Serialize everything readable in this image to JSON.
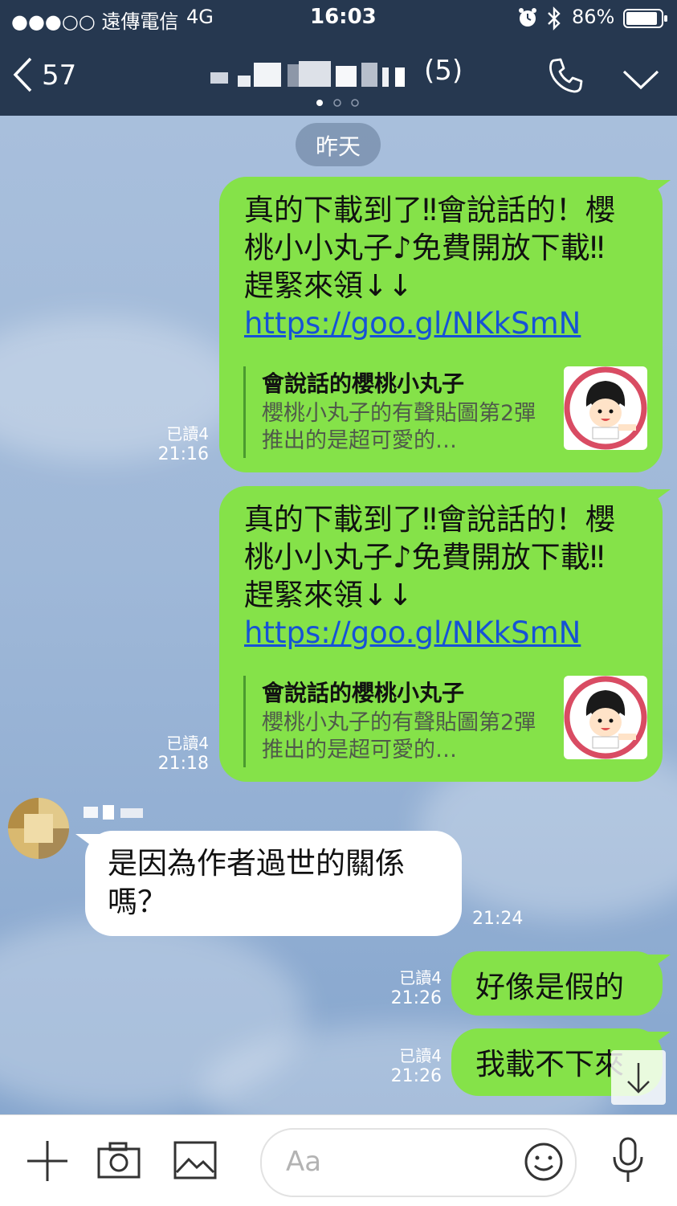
{
  "status": {
    "carrier": "●●●○○ 遠傳電信",
    "network": "4G",
    "time": "16:03",
    "battery": "86%"
  },
  "nav": {
    "back_count": "57",
    "member_count": "(5)"
  },
  "chat": {
    "date_label": "昨天",
    "messages": [
      {
        "text": "真的下載到了‼會說話的！櫻桃小小丸子♪免費開放下載‼趕緊來領↓↓",
        "link": "https://goo.gl/NKkSmN",
        "preview_title": "會說話的櫻桃小丸子",
        "preview_desc": "櫻桃小丸子的有聲貼圖第2彈推出的是超可愛的…",
        "read": "已讀4",
        "time": "21:16"
      },
      {
        "text": "真的下載到了‼會說話的！櫻桃小小丸子♪免費開放下載‼趕緊來領↓↓",
        "link": "https://goo.gl/NKkSmN",
        "preview_title": "會說話的櫻桃小丸子",
        "preview_desc": "櫻桃小丸子的有聲貼圖第2彈推出的是超可愛的…",
        "read": "已讀4",
        "time": "21:18"
      },
      {
        "text": "是因為作者過世的關係嗎？",
        "time": "21:24"
      },
      {
        "text": "好像是假的",
        "read": "已讀4",
        "time": "21:26"
      },
      {
        "text": "我載不下來",
        "read": "已讀4",
        "time": "21:26"
      }
    ]
  },
  "input": {
    "placeholder": "Aa"
  },
  "colors": {
    "header_bg": "#263850",
    "sent_bubble": "#85e249",
    "received_bubble": "#ffffff",
    "link": "#1652d6"
  }
}
